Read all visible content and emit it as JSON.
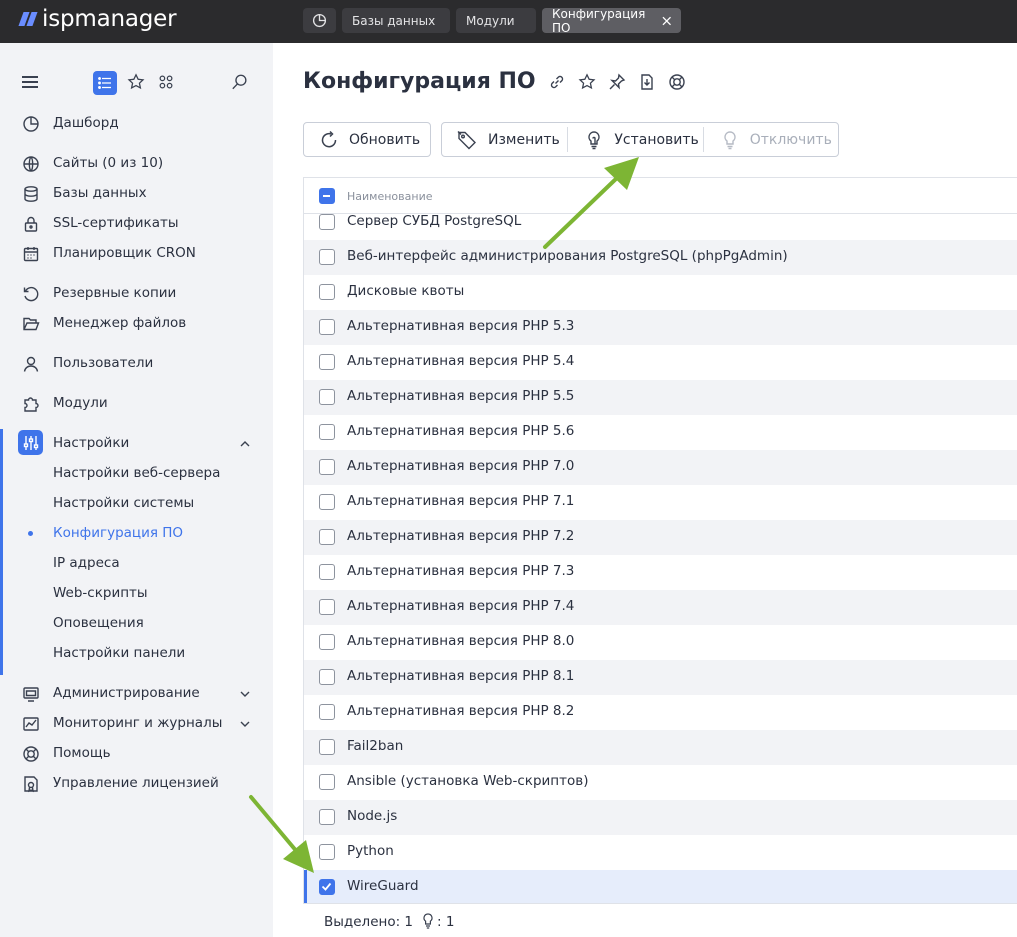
{
  "app": {
    "logo": "ispmanager"
  },
  "tabs": [
    {
      "label": "Базы данных"
    },
    {
      "label": "Модули"
    },
    {
      "label": "Конфигурация ПО"
    }
  ],
  "sidebar": {
    "items": [
      {
        "label": "Дашборд",
        "icon": "dashboard-icon"
      },
      {
        "label": "Сайты (0 из 10)",
        "icon": "globe-icon"
      },
      {
        "label": "Базы данных",
        "icon": "database-icon"
      },
      {
        "label": "SSL-сертификаты",
        "icon": "lock-icon"
      },
      {
        "label": "Планировщик CRON",
        "icon": "calendar-icon"
      },
      {
        "label": "Резервные копии",
        "icon": "backup-icon"
      },
      {
        "label": "Менеджер файлов",
        "icon": "folder-icon"
      },
      {
        "label": "Пользователи",
        "icon": "user-icon"
      },
      {
        "label": "Модули",
        "icon": "puzzle-icon"
      },
      {
        "label": "Настройки",
        "icon": "sliders-icon"
      }
    ],
    "settings_sub": [
      {
        "label": "Настройки веб-сервера"
      },
      {
        "label": "Настройки системы"
      },
      {
        "label": "Конфигурация ПО",
        "active": true
      },
      {
        "label": "IP адреса"
      },
      {
        "label": "Web-скрипты"
      },
      {
        "label": "Оповещения"
      },
      {
        "label": "Настройки панели"
      }
    ],
    "bottom": [
      {
        "label": "Администрирование",
        "icon": "monitor-icon"
      },
      {
        "label": "Мониторинг и журналы",
        "icon": "chart-icon"
      },
      {
        "label": "Помощь",
        "icon": "lifebuoy-icon"
      },
      {
        "label": "Управление лицензией",
        "icon": "license-icon"
      }
    ]
  },
  "page": {
    "title": "Конфигурация ПО"
  },
  "toolbar": {
    "refresh": "Обновить",
    "edit": "Изменить",
    "install": "Установить",
    "disable": "Отключить"
  },
  "table": {
    "header": "Наименование",
    "rows": [
      {
        "name": "Сервер СУБД PostgreSQL",
        "checked": false
      },
      {
        "name": "Веб-интерфейс администрирования PostgreSQL (phpPgAdmin)",
        "checked": false
      },
      {
        "name": "Дисковые квоты",
        "checked": false
      },
      {
        "name": "Альтернативная версия PHP 5.3",
        "checked": false
      },
      {
        "name": "Альтернативная версия PHP 5.4",
        "checked": false
      },
      {
        "name": "Альтернативная версия PHP 5.5",
        "checked": false
      },
      {
        "name": "Альтернативная версия PHP 5.6",
        "checked": false
      },
      {
        "name": "Альтернативная версия PHP 7.0",
        "checked": false
      },
      {
        "name": "Альтернативная версия PHP 7.1",
        "checked": false
      },
      {
        "name": "Альтернативная версия PHP 7.2",
        "checked": false
      },
      {
        "name": "Альтернативная версия PHP 7.3",
        "checked": false
      },
      {
        "name": "Альтернативная версия PHP 7.4",
        "checked": false
      },
      {
        "name": "Альтернативная версия PHP 8.0",
        "checked": false
      },
      {
        "name": "Альтернативная версия PHP 8.1",
        "checked": false
      },
      {
        "name": "Альтернативная версия PHP 8.2",
        "checked": false
      },
      {
        "name": "Fail2ban",
        "checked": false
      },
      {
        "name": "Ansible (установка Web-скриптов)",
        "checked": false
      },
      {
        "name": "Node.js",
        "checked": false
      },
      {
        "name": "Python",
        "checked": false
      },
      {
        "name": "WireGuard",
        "checked": true
      }
    ]
  },
  "footer": {
    "selected": "Выделено: 1",
    "install_count": ": 1"
  },
  "colors": {
    "accent": "#3f74ea",
    "annotation_arrow": "#7db534"
  }
}
